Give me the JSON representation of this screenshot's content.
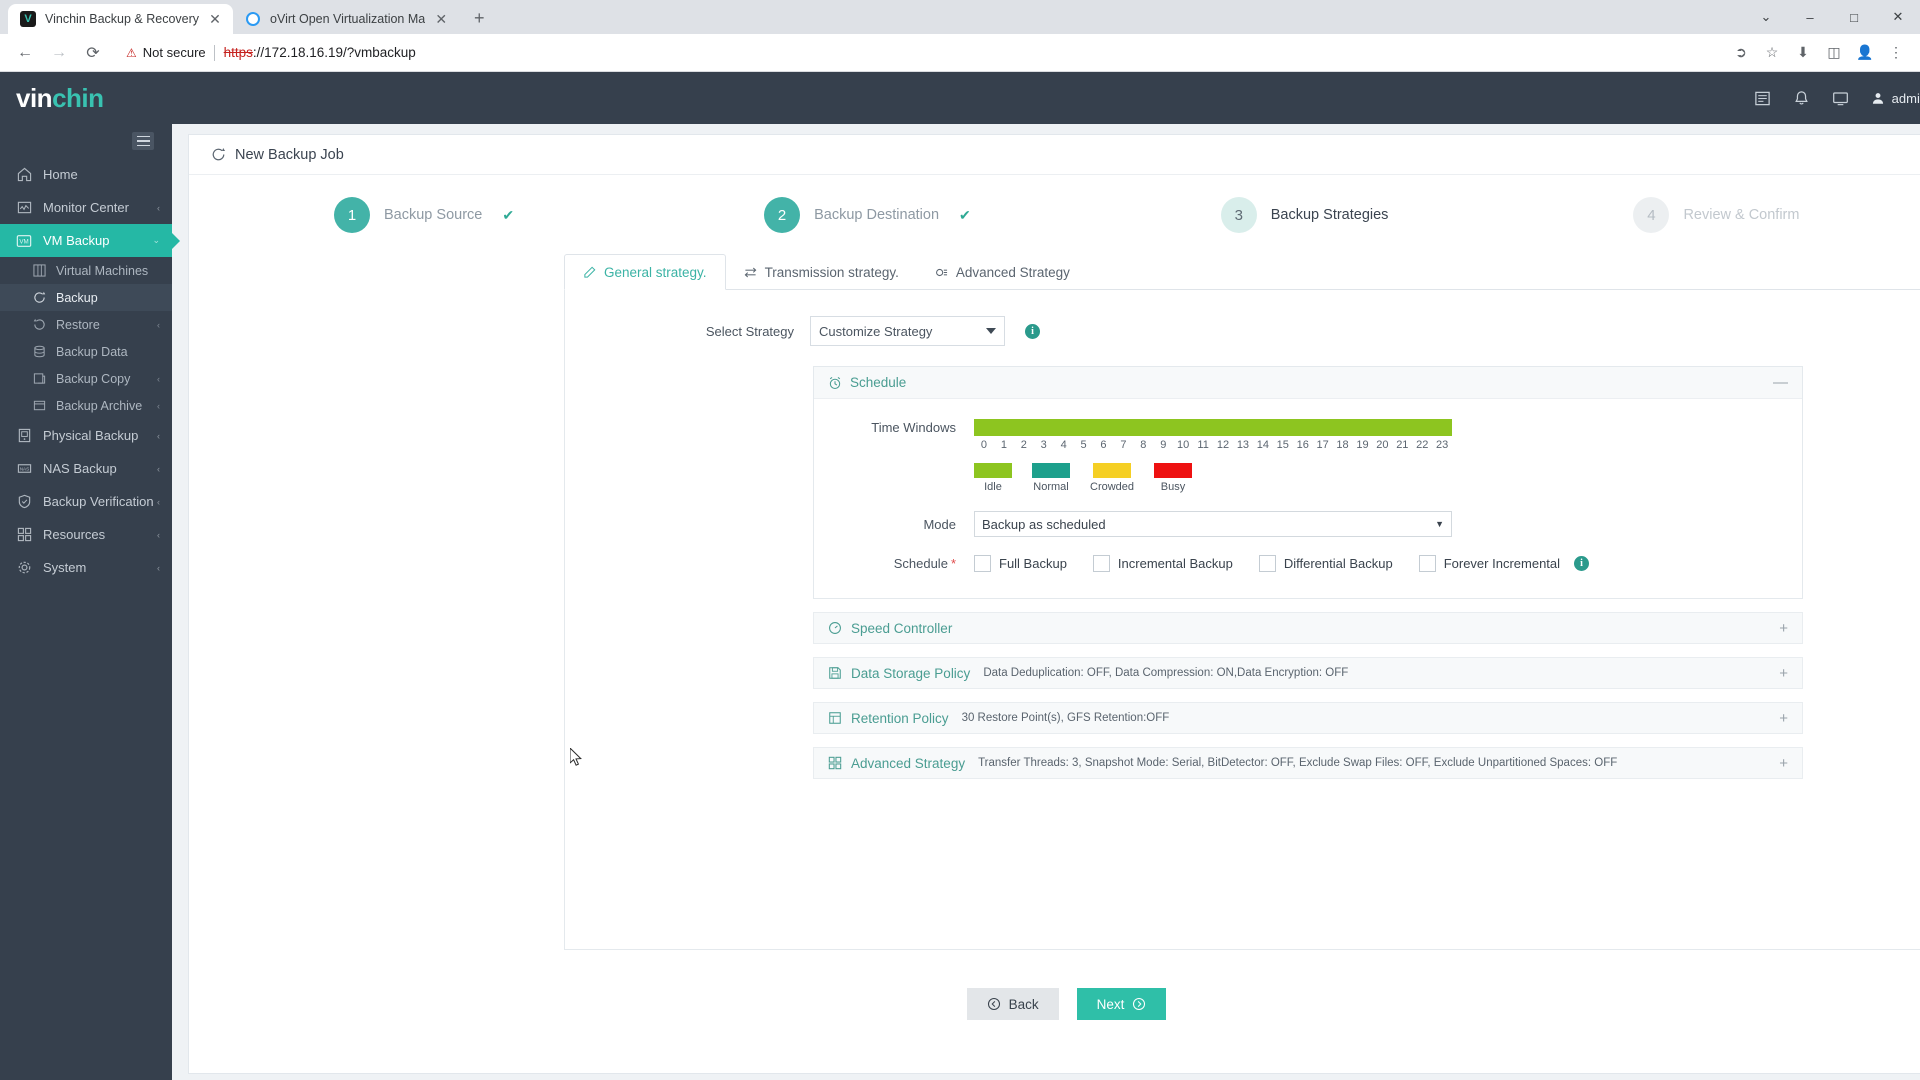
{
  "browser": {
    "tabs": [
      {
        "title": "Vinchin Backup & Recovery",
        "favicon": "vinchin-icon",
        "active": true
      },
      {
        "title": "oVirt Open Virtualization Ma",
        "favicon": "ovirt-icon",
        "active": false
      }
    ],
    "new_tab_label": "+",
    "window_controls": {
      "minimize": "–",
      "maximize": "□",
      "close": "✕",
      "more": "⌄"
    },
    "nav": {
      "back": "←",
      "forward": "→",
      "reload": "⟳"
    },
    "security_label": "Not secure",
    "url_scheme": "https",
    "url_rest": "://172.18.16.19/?vmbackup",
    "toolbar_icons": [
      "share-icon",
      "bookmark-star-icon",
      "downloads-icon",
      "sidepanel-icon",
      "profile-icon",
      "more-menu-icon"
    ]
  },
  "topbar": {
    "brand_first": "vin",
    "brand_second": "chin",
    "icons": [
      "document-icon",
      "bell-icon",
      "monitor-icon"
    ],
    "user_label": "admin"
  },
  "sidebar": {
    "items": [
      {
        "label": "Home",
        "icon": "home-icon",
        "active": false,
        "caret": ""
      },
      {
        "label": "Monitor Center",
        "icon": "monitor-chart-icon",
        "active": false,
        "caret": "‹"
      },
      {
        "label": "VM Backup",
        "icon": "vm-icon",
        "active": true,
        "caret": "⌄"
      }
    ],
    "sub_items": [
      {
        "label": "Virtual Machines",
        "icon": "grid-icon",
        "selected": false,
        "caret": ""
      },
      {
        "label": "Backup",
        "icon": "refresh-icon",
        "selected": true,
        "caret": ""
      },
      {
        "label": "Restore",
        "icon": "restore-icon",
        "selected": false,
        "caret": "‹"
      },
      {
        "label": "Backup Data",
        "icon": "database-icon",
        "selected": false,
        "caret": ""
      },
      {
        "label": "Backup Copy",
        "icon": "copy-icon",
        "selected": false,
        "caret": "‹"
      },
      {
        "label": "Backup Archive",
        "icon": "archive-icon",
        "selected": false,
        "caret": "‹"
      }
    ],
    "items_bottom": [
      {
        "label": "Physical Backup",
        "icon": "server-icon",
        "caret": "‹"
      },
      {
        "label": "NAS Backup",
        "icon": "nas-icon",
        "caret": "‹"
      },
      {
        "label": "Backup Verification",
        "icon": "shield-check-icon",
        "caret": "‹"
      },
      {
        "label": "Resources",
        "icon": "resources-icon",
        "caret": "‹"
      },
      {
        "label": "System",
        "icon": "gear-icon",
        "caret": "‹"
      }
    ]
  },
  "page": {
    "title": "New Backup Job",
    "title_icon": "refresh-icon"
  },
  "stepper": {
    "steps": [
      {
        "number": "1",
        "label": "Backup Source",
        "state": "done",
        "check": "✔"
      },
      {
        "number": "2",
        "label": "Backup Destination",
        "state": "done",
        "check": "✔"
      },
      {
        "number": "3",
        "label": "Backup Strategies",
        "state": "current",
        "check": ""
      },
      {
        "number": "4",
        "label": "Review & Confirm",
        "state": "todo",
        "check": ""
      }
    ]
  },
  "tabs": [
    {
      "label": "General strategy.",
      "icon": "pencil-icon",
      "active": true
    },
    {
      "label": "Transmission strategy.",
      "icon": "transfer-icon",
      "active": false
    },
    {
      "label": "Advanced Strategy",
      "icon": "settings-sliders-icon",
      "active": false
    }
  ],
  "general_strategy": {
    "select_strategy_label": "Select Strategy",
    "select_strategy_value": "Customize Strategy",
    "select_strategy_info": "i",
    "schedule_panel": {
      "title": "Schedule",
      "icon": "alarm-clock-icon",
      "collapse_glyph": "—",
      "time_windows_label": "Time Windows",
      "hours": [
        "0",
        "1",
        "2",
        "3",
        "4",
        "5",
        "6",
        "7",
        "8",
        "9",
        "10",
        "11",
        "12",
        "13",
        "14",
        "15",
        "16",
        "17",
        "18",
        "19",
        "20",
        "21",
        "22",
        "23"
      ],
      "time_window_state": "Idle",
      "legend": [
        {
          "label": "Idle",
          "color": "#8dc520"
        },
        {
          "label": "Normal",
          "color": "#1da08c"
        },
        {
          "label": "Crowded",
          "color": "#f5cf24"
        },
        {
          "label": "Busy",
          "color": "#ee1111"
        }
      ],
      "mode_label": "Mode",
      "mode_value": "Backup as scheduled",
      "schedule_label": "Schedule",
      "schedule_required": "*",
      "schedule_options": [
        {
          "label": "Full Backup",
          "checked": false
        },
        {
          "label": "Incremental Backup",
          "checked": false
        },
        {
          "label": "Differential Backup",
          "checked": false
        },
        {
          "label": "Forever Incremental",
          "checked": false
        }
      ],
      "schedule_info": "i"
    },
    "sections": [
      {
        "title": "Speed Controller",
        "icon": "speedometer-icon",
        "summary": "",
        "expand_glyph": "+"
      },
      {
        "title": "Data Storage Policy",
        "icon": "save-disk-icon",
        "summary": "Data Deduplication: OFF, Data Compression: ON,Data Encryption: OFF",
        "expand_glyph": "+"
      },
      {
        "title": "Retention Policy",
        "icon": "retention-icon",
        "summary": "30 Restore Point(s), GFS Retention:OFF",
        "expand_glyph": "+"
      },
      {
        "title": "Advanced Strategy",
        "icon": "grid-blocks-icon",
        "summary": "Transfer Threads: 3, Snapshot Mode: Serial, BitDetector: OFF, Exclude Swap Files: OFF, Exclude Unpartitioned Spaces: OFF",
        "expand_glyph": "+"
      }
    ]
  },
  "footer": {
    "back_label": "Back",
    "back_icon": "arrow-left-circle-icon",
    "next_label": "Next",
    "next_icon": "arrow-right-circle-icon"
  },
  "colors": {
    "brand_teal": "#39c2b1",
    "sidebar_bg": "#36404d",
    "active_nav": "#25b8a5",
    "idle_green": "#8dc520",
    "busy_red": "#ee1111"
  }
}
